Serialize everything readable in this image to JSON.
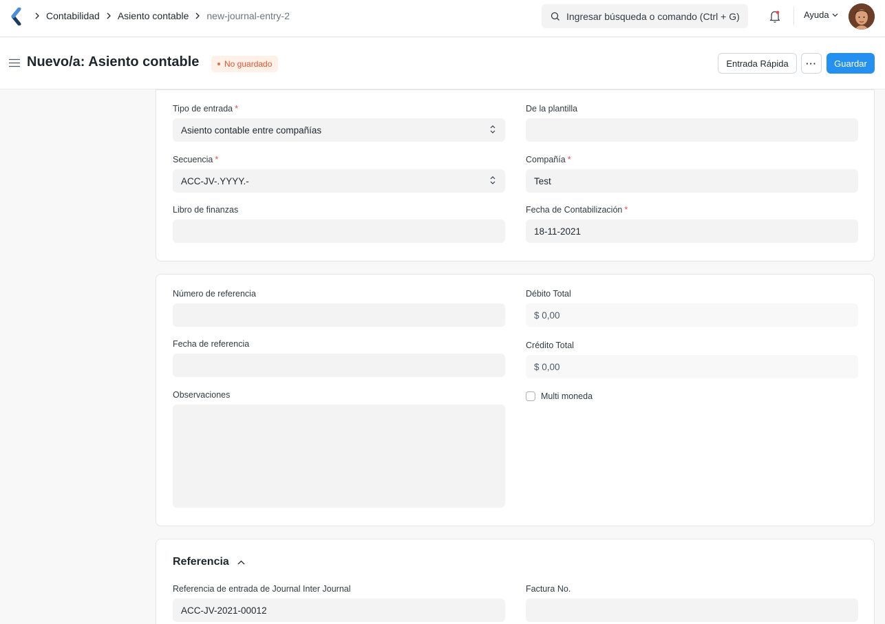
{
  "breadcrumb": [
    "Contabilidad",
    "Asiento contable",
    "new-journal-entry-2"
  ],
  "search": {
    "placeholder": "Ingresar búsqueda o comando (Ctrl + G)"
  },
  "navbar": {
    "help_label": "Ayuda"
  },
  "page": {
    "title": "Nuevo/a: Asiento contable",
    "status": "No guardado",
    "quick_entry_label": "Entrada Rápida",
    "more_label": "···",
    "save_label": "Guardar"
  },
  "section1": {
    "entry_type": {
      "label": "Tipo de entrada",
      "value": "Asiento contable entre compañías"
    },
    "template": {
      "label": "De la plantilla",
      "value": ""
    },
    "series": {
      "label": "Secuencia",
      "value": "ACC-JV-.YYYY.-"
    },
    "company": {
      "label": "Compañía",
      "value": "Test"
    },
    "finance_book": {
      "label": "Libro de finanzas",
      "value": ""
    },
    "posting_date": {
      "label": "Fecha de Contabilización",
      "value": "18-11-2021"
    }
  },
  "section2": {
    "ref_no": {
      "label": "Número de referencia",
      "value": ""
    },
    "total_debit": {
      "label": "Débito Total",
      "value": "$ 0,00"
    },
    "ref_date": {
      "label": "Fecha de referencia",
      "value": ""
    },
    "total_credit": {
      "label": "Crédito Total",
      "value": "$ 0,00"
    },
    "remarks": {
      "label": "Observaciones"
    },
    "multi_currency": {
      "label": "Multi moneda",
      "checked": false
    }
  },
  "section3": {
    "title": "Referencia",
    "inter_journal": {
      "label": "Referencia de entrada de Journal Inter Journal",
      "value": "ACC-JV-2021-00012"
    },
    "invoice_no": {
      "label": "Factura No.",
      "value": ""
    }
  },
  "colors": {
    "primary": "#2490ef",
    "status_orange": "#e2542c",
    "required": "#e24c4c"
  }
}
